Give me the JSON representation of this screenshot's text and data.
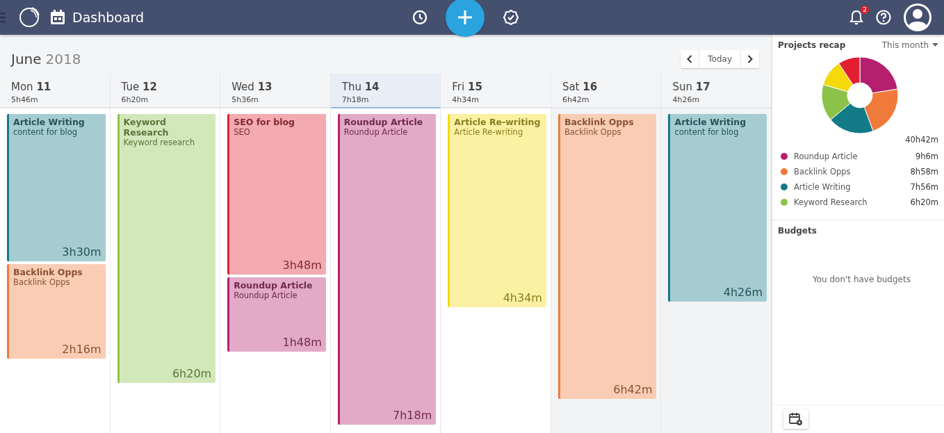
{
  "topbar": {
    "title": "Dashboard",
    "notification_count": "2"
  },
  "calendar": {
    "month": "June",
    "year": "2018",
    "today_button": "Today",
    "days": [
      {
        "label": "Mon **11**",
        "total": "5h46m",
        "selected": false,
        "weekend": false,
        "entries": [
          {
            "title": "Article Writing",
            "subtitle": "content for blog",
            "duration": "3h30m",
            "color": "#137a87"
          },
          {
            "title": "Backlink Opps",
            "subtitle": "Backlink Opps",
            "duration": "2h16m",
            "color": "#f07a3a"
          }
        ]
      },
      {
        "label": "Tue **12**",
        "total": "6h20m",
        "selected": false,
        "weekend": false,
        "entries": [
          {
            "title": "Keyword Research",
            "subtitle": "Keyword research",
            "duration": "6h20m",
            "color": "#8bc34a"
          }
        ]
      },
      {
        "label": "Wed **13**",
        "total": "5h36m",
        "selected": false,
        "weekend": false,
        "entries": [
          {
            "title": "SEO for blog",
            "subtitle": "SEO",
            "duration": "3h48m",
            "color": "#e02030"
          },
          {
            "title": "Roundup Article",
            "subtitle": "Roundup Article",
            "duration": "1h48m",
            "color": "#b51f6e"
          }
        ]
      },
      {
        "label": "Thu **14**",
        "total": "7h18m",
        "selected": true,
        "weekend": false,
        "entries": [
          {
            "title": "Roundup Article",
            "subtitle": "Roundup Article",
            "duration": "7h18m",
            "color": "#b51f6e"
          }
        ]
      },
      {
        "label": "Fri **15**",
        "total": "4h34m",
        "selected": false,
        "weekend": false,
        "entries": [
          {
            "title": "Article Re-writing",
            "subtitle": "Article Re-writing",
            "duration": "4h34m",
            "color": "#f5d90a"
          }
        ]
      },
      {
        "label": "Sat **16**",
        "total": "6h42m",
        "selected": false,
        "weekend": true,
        "entries": [
          {
            "title": "Backlink Opps",
            "subtitle": "Backlink Opps",
            "duration": "6h42m",
            "color": "#f07a3a"
          }
        ]
      },
      {
        "label": "Sun **17**",
        "total": "4h26m",
        "selected": false,
        "weekend": true,
        "entries": [
          {
            "title": "Article Writing",
            "subtitle": "content for blog",
            "duration": "4h26m",
            "color": "#137a87"
          }
        ]
      }
    ]
  },
  "projects_recap": {
    "title": "Projects recap",
    "period": "This month",
    "total": "40h42m",
    "items": [
      {
        "name": "Roundup Article",
        "time": "9h6m",
        "color": "#b51f6e"
      },
      {
        "name": "Backlink Opps",
        "time": "8h58m",
        "color": "#f07a3a"
      },
      {
        "name": "Article Writing",
        "time": "7h56m",
        "color": "#137a87"
      },
      {
        "name": "Keyword Research",
        "time": "6h20m",
        "color": "#8bc34a"
      }
    ]
  },
  "budgets": {
    "title": "Budgets",
    "empty_message": "You don't have budgets"
  }
}
